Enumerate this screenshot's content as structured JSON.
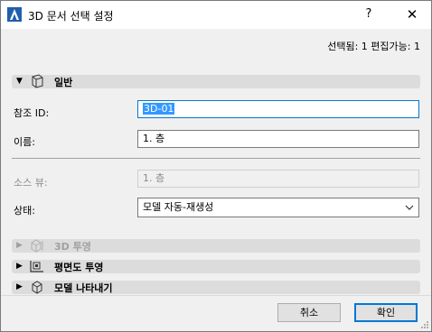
{
  "window": {
    "title": "3D 문서 선택 설정",
    "help_label": "?",
    "close_label": "✕"
  },
  "selection_info": "선택됨: 1 편집가능: 1",
  "sections": {
    "general": {
      "title": "일반",
      "icon": "document-3d-icon",
      "expanded": true
    },
    "projection_3d": {
      "title": "3D 투영",
      "icon": "3d-projection-icon",
      "enabled": false
    },
    "floorplan_projection": {
      "title": "평면도 투영",
      "icon": "floorplan-projection-icon"
    },
    "model_display": {
      "title": "모델 나타내기",
      "icon": "model-cube-icon"
    }
  },
  "fields": {
    "reference_id": {
      "label": "참조 ID:",
      "value": "3D-01"
    },
    "name": {
      "label": "이름:",
      "value": "1. 층"
    },
    "source_view": {
      "label": "소스 뷰:",
      "value": "1. 층"
    },
    "status": {
      "label": "상태:",
      "value": "모델 자동-재생성"
    }
  },
  "buttons": {
    "cancel": "취소",
    "ok": "확인"
  },
  "colors": {
    "accent": "#0078d7",
    "selection": "#3399ff",
    "section_bg": "#dcdcdc",
    "dialog_bg": "#f0f0f0"
  }
}
